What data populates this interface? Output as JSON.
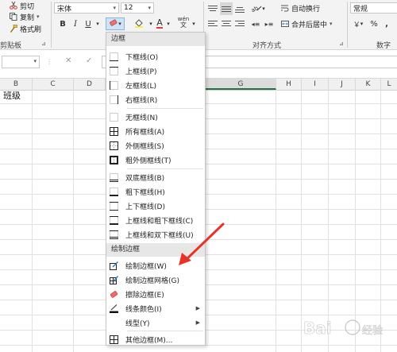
{
  "ribbon": {
    "clipboard": {
      "cut": "剪切",
      "copy": "复制",
      "format_painter": "格式刷",
      "group_label": "剪贴板"
    },
    "font": {
      "name": "宋体",
      "size": "12",
      "bold": "B",
      "italic": "I",
      "underline": "U",
      "wen": "wén"
    },
    "alignment": {
      "wrap_text": "自动换行",
      "merge_center": "合并后居中",
      "group_label": "对齐方式"
    },
    "number": {
      "format": "常规",
      "percent": "%",
      "comma": ",",
      "group_label": "数字"
    }
  },
  "formula_bar": {
    "cancel": "✕",
    "enter": "✓"
  },
  "grid": {
    "columns": [
      "B",
      "C",
      "D",
      "G",
      "H",
      "I",
      "J",
      "K",
      "L"
    ],
    "row1": {
      "B1": "班级"
    }
  },
  "menu": {
    "header_borders": "边框",
    "items": [
      {
        "label": "下框线(O)",
        "icon": "bottom-border"
      },
      {
        "label": "上框线(P)",
        "icon": "top-border"
      },
      {
        "label": "左框线(L)",
        "icon": "left-border"
      },
      {
        "label": "右框线(R)",
        "icon": "right-border"
      },
      {
        "label": "无框线(N)",
        "icon": "no-border"
      },
      {
        "label": "所有框线(A)",
        "icon": "all-borders"
      },
      {
        "label": "外侧框线(S)",
        "icon": "outside-borders"
      },
      {
        "label": "粗外侧框线(T)",
        "icon": "thick-outside-borders"
      },
      {
        "label": "双底框线(B)",
        "icon": "double-bottom-border"
      },
      {
        "label": "粗下框线(H)",
        "icon": "thick-bottom-border"
      },
      {
        "label": "上下框线(D)",
        "icon": "top-bottom-border"
      },
      {
        "label": "上框线和粗下框线(C)",
        "icon": "top-thick-bottom-border"
      },
      {
        "label": "上框线和双下框线(U)",
        "icon": "top-double-bottom-border"
      }
    ],
    "header_draw": "绘制边框",
    "draw_items": [
      {
        "label": "绘制边框(W)",
        "icon": "draw-border"
      },
      {
        "label": "绘制边框网格(G)",
        "icon": "draw-border-grid"
      },
      {
        "label": "擦除边框(E)",
        "icon": "eraser"
      },
      {
        "label": "线条颜色(I)",
        "icon": "line-color",
        "submenu": true
      },
      {
        "label": "线型(Y)",
        "icon": "line-style",
        "submenu": true
      },
      {
        "label": "其他边框(M)...",
        "icon": "more-borders"
      }
    ]
  },
  "colors": {
    "accent_green": "#217346",
    "annotation_red": "#e8332a",
    "menu_highlight": "#cfe3f7"
  }
}
